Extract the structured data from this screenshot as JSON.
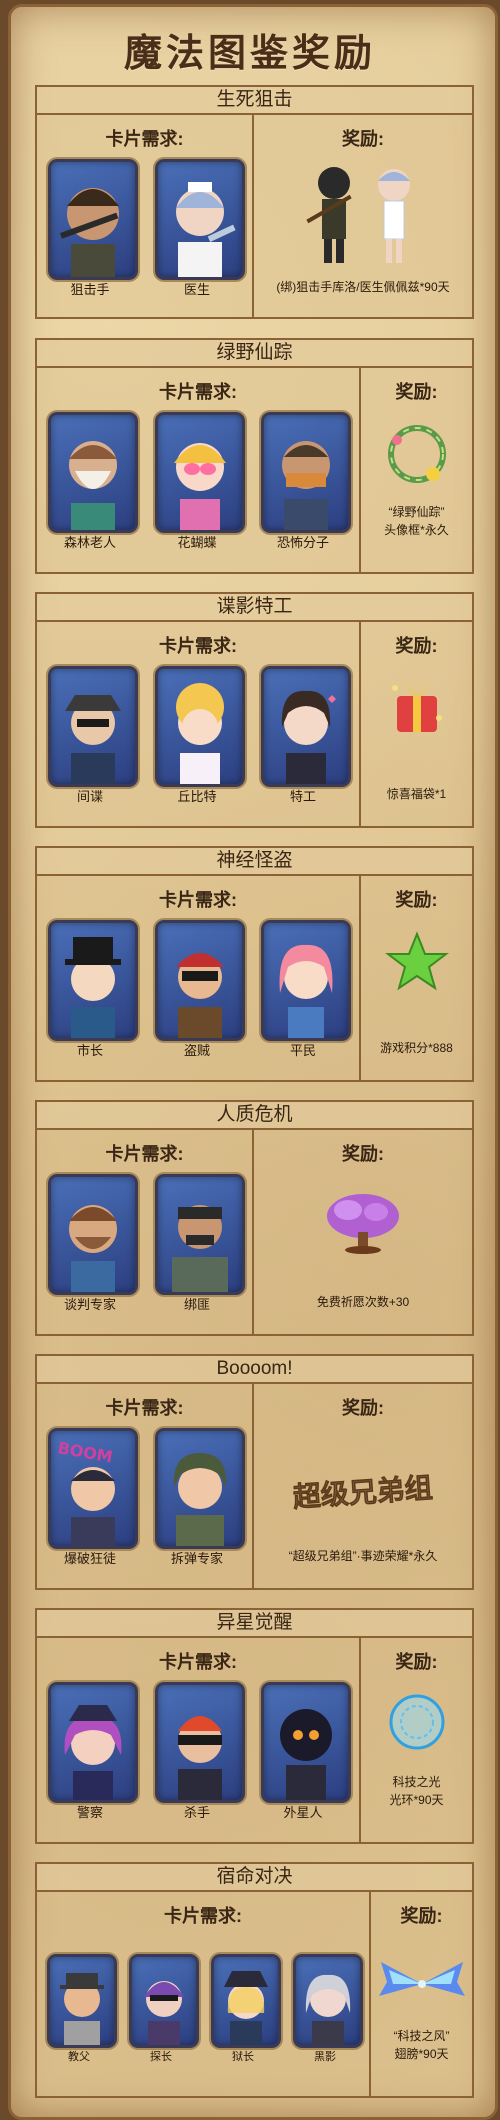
{
  "title": "魔法图鉴奖励",
  "labels": {
    "requirement": "卡片需求:",
    "reward": "奖励:"
  },
  "sections": [
    {
      "name": "生死狙击",
      "cards": [
        "狙击手",
        "医生"
      ],
      "reward": [
        "(绑)狙击手库洛/医生佩佩兹*90天"
      ]
    },
    {
      "name": "绿野仙踪",
      "cards": [
        "森林老人",
        "花蝴蝶",
        "恐怖分子"
      ],
      "reward": [
        "“绿野仙踪”",
        "头像框*永久"
      ]
    },
    {
      "name": "谍影特工",
      "cards": [
        "间谍",
        "丘比特",
        "特工"
      ],
      "reward": [
        "惊喜福袋*1"
      ]
    },
    {
      "name": "神经怪盗",
      "cards": [
        "市长",
        "盗贼",
        "平民"
      ],
      "reward": [
        "游戏积分*888"
      ]
    },
    {
      "name": "人质危机",
      "cards": [
        "谈判专家",
        "绑匪"
      ],
      "reward": [
        "免费祈愿次数+30"
      ]
    },
    {
      "name": "Boooom!",
      "cards": [
        "爆破狂徒",
        "拆弹专家"
      ],
      "reward": [
        "“超级兄弟组”·事迹荣耀*永久"
      ],
      "reward_art": "超级兄弟组",
      "card_badge": "BOOM"
    },
    {
      "name": "异星觉醒",
      "cards": [
        "警察",
        "杀手",
        "外星人"
      ],
      "reward": [
        "科技之光",
        "光环*90天"
      ]
    },
    {
      "name": "宿命对决",
      "cards": [
        "教父",
        "探长",
        "狱长",
        "黑影"
      ],
      "reward": [
        "“科技之风”",
        "翅膀*90天"
      ]
    }
  ]
}
